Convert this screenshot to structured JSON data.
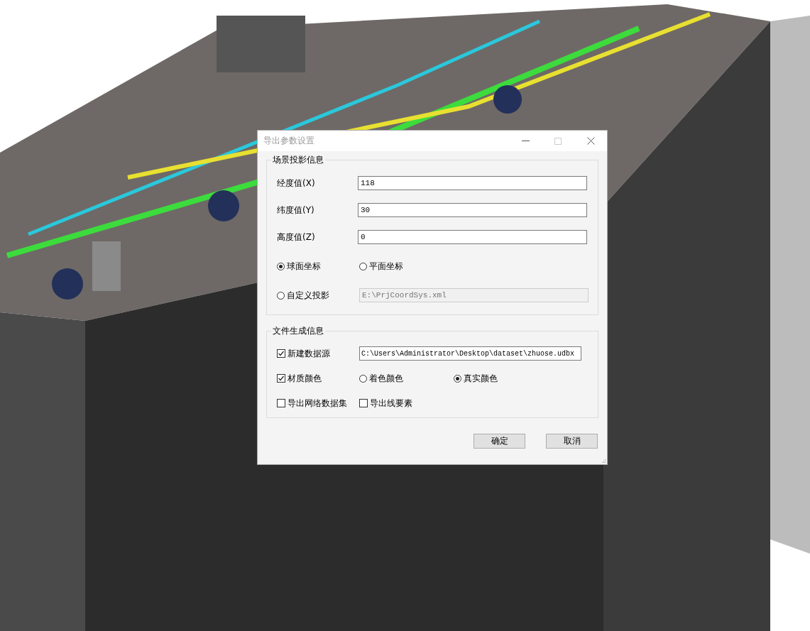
{
  "window": {
    "title": "导出参数设置",
    "active": false,
    "maximize_disabled": true
  },
  "projection": {
    "title": "场景投影信息",
    "fields": [
      {
        "label": "经度值(X)",
        "value": "118"
      },
      {
        "label": "纬度值(Y)",
        "value": "30"
      },
      {
        "label": "高度值(Z)",
        "value": "0"
      }
    ],
    "options": [
      {
        "label": "球面坐标",
        "selected": true
      },
      {
        "label": "平面坐标",
        "selected": false
      },
      {
        "label": "自定义投影",
        "selected": false,
        "path": {
          "value": "E:\\PrjCoordSys.xml",
          "disabled": true
        }
      }
    ]
  },
  "file": {
    "title": "文件生成信息",
    "new_datasource": {
      "label": "新建数据源",
      "checked": true,
      "value": "C:\\Users\\Administrator\\Desktop\\dataset\\zhuose.udbx"
    },
    "material_color": {
      "label": "材质颜色",
      "checked": true
    },
    "color_modes": [
      {
        "label": "着色颜色",
        "selected": false
      },
      {
        "label": "真实颜色",
        "selected": true
      }
    ],
    "export_network": {
      "label": "导出网络数据集",
      "checked": false
    },
    "export_lines": {
      "label": "导出线要素",
      "checked": false
    }
  },
  "buttons": [
    "确定",
    "取消"
  ]
}
